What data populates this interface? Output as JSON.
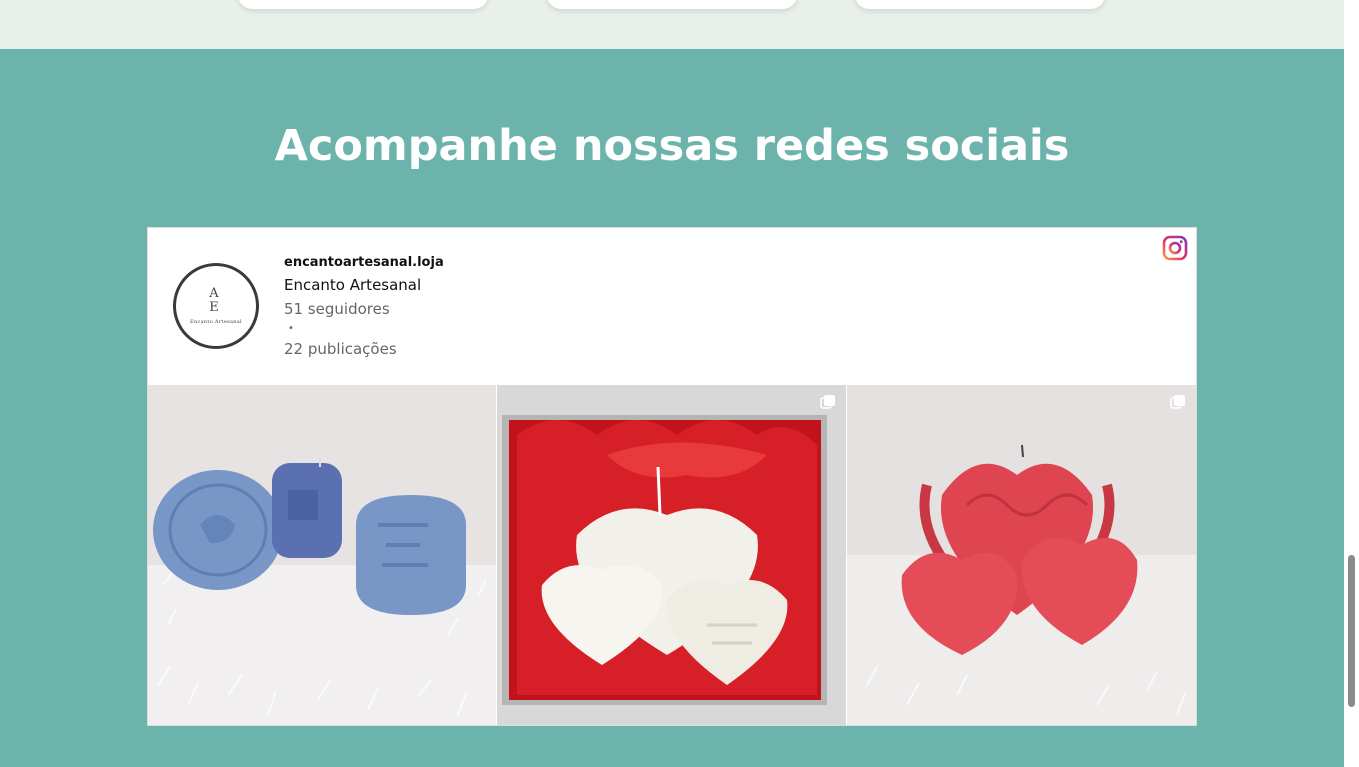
{
  "section": {
    "title": "Acompanhe nossas redes sociais"
  },
  "instagram": {
    "username": "encantoartesanal.loja",
    "full_name": "Encanto Artesanal",
    "followers": "51 seguidores",
    "separator": "•",
    "posts_count": "22 publicações",
    "avatar": {
      "monogram_top": "A",
      "monogram_bottom": "E",
      "brand_text": "Encanto Artesanal"
    },
    "posts": [
      {
        "subject": "blue-candles",
        "multi": false
      },
      {
        "subject": "white-heart-candles-gift-box",
        "multi": true
      },
      {
        "subject": "red-heart-candles",
        "multi": true
      }
    ]
  },
  "icons": {
    "instagram": "instagram-icon",
    "multi_image": "multiple-images-icon"
  },
  "colors": {
    "section_bg": "#6bb3ab",
    "top_band_bg": "#e9f0ea",
    "title": "#ffffff"
  }
}
